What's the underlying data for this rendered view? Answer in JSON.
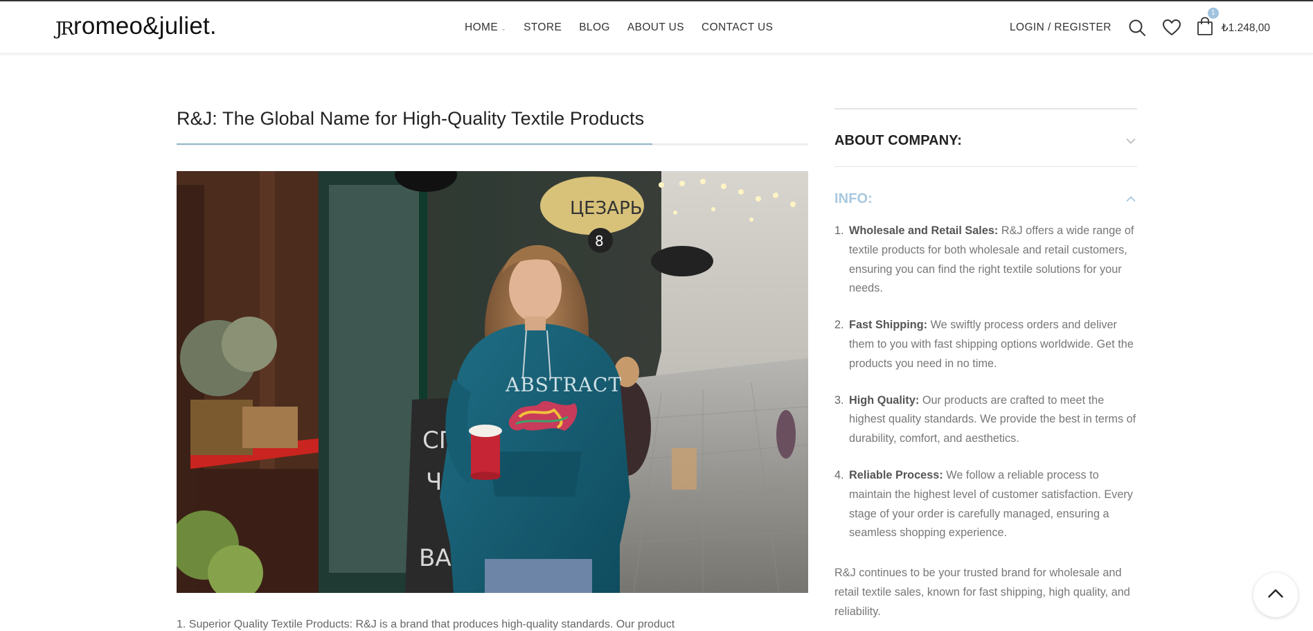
{
  "brand": {
    "mark": "JR",
    "name": "romeo&juliet."
  },
  "nav": {
    "items": [
      {
        "label": "HOME",
        "has_dropdown": true
      },
      {
        "label": "STORE"
      },
      {
        "label": "BLOG"
      },
      {
        "label": "ABOUT US"
      },
      {
        "label": "CONTACT US"
      }
    ]
  },
  "header": {
    "login_label": "LOGIN / REGISTER",
    "cart_count": "1",
    "cart_total": "₺1.248,00",
    "icons": [
      "search-icon",
      "heart-icon",
      "shopping-bag-icon"
    ]
  },
  "article": {
    "title": "R&J: The Global Name for High-Quality Textile Products",
    "hero_image_alt": "ABSTRACT",
    "partial_text": "1. Superior Quality Textile Products: R&J is a brand that produces high-quality standards. Our product"
  },
  "sidebar": {
    "about_heading": "ABOUT COMPANY:",
    "info_heading": "INFO:",
    "items": [
      {
        "num": "1.",
        "title": "Wholesale and Retail Sales:",
        "text": " R&J offers a wide range of textile products for both wholesale and retail customers, ensuring you can find the right textile solutions for your needs."
      },
      {
        "num": "2.",
        "title": "Fast Shipping:",
        "text": " We swiftly process orders and deliver them to you with fast shipping options worldwide. Get the products you need in no time."
      },
      {
        "num": "3.",
        "title": "High Quality:",
        "text": " Our products are crafted to meet the highest quality standards. We provide the best in terms of durability, comfort, and aesthetics."
      },
      {
        "num": "4.",
        "title": "Reliable Process:",
        "text": " We follow a reliable process to maintain the highest level of customer satisfaction. Every stage of your order is carefully managed, ensuring a seamless shopping experience."
      }
    ],
    "closing": "R&J continues to be your trusted brand for wholesale and retail textile sales, known for fast shipping, high quality, and reliability."
  },
  "colors": {
    "accent": "#a8c8df",
    "title_rule": "#8fb8c6",
    "badge": "#9fc3df"
  }
}
